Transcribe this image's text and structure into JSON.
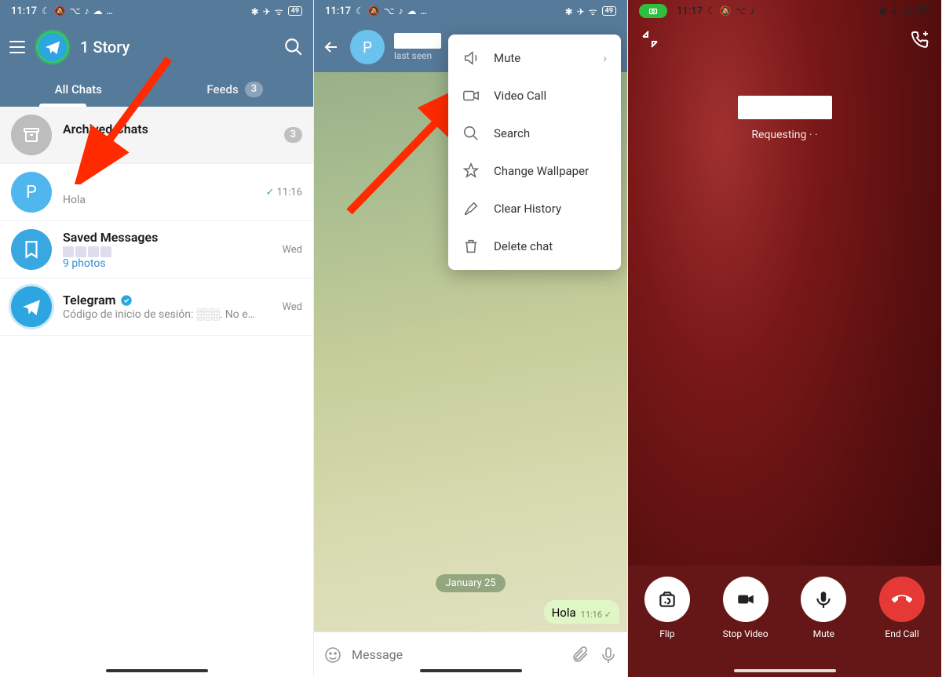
{
  "status": {
    "time": "11:17",
    "icons_left": "☾ 🔕 ⌥ ♪ ☁ …",
    "icons_right": "✱ ✈ ᯤ",
    "battery": "49"
  },
  "screen1": {
    "title": "1 Story",
    "tabs": {
      "all": "All Chats",
      "feeds": "Feeds",
      "feeds_count": "3"
    },
    "archived": {
      "title": "Archived Chats",
      "count": "3"
    },
    "chats": [
      {
        "avatar": "P",
        "name": "",
        "sub": "Hola",
        "time": "11:16"
      },
      {
        "title": "Saved Messages",
        "sub": "9 photos",
        "time": "Wed"
      },
      {
        "title": "Telegram",
        "sub": "Código de inicio de sesión: ░░░. No e…",
        "time": "Wed"
      }
    ]
  },
  "screen2": {
    "avatar": "P",
    "status_text": "last seen",
    "menu": {
      "mute": "Mute",
      "video": "Video Call",
      "search": "Search",
      "wallpaper": "Change Wallpaper",
      "clear": "Clear History",
      "delete": "Delete chat"
    },
    "date": "January 25",
    "message": "Hola",
    "msg_time": "11:16",
    "input_placeholder": "Message"
  },
  "screen3": {
    "status": "Requesting · ·",
    "buttons": {
      "flip": "Flip",
      "stop": "Stop Video",
      "mute": "Mute",
      "end": "End Call"
    }
  }
}
